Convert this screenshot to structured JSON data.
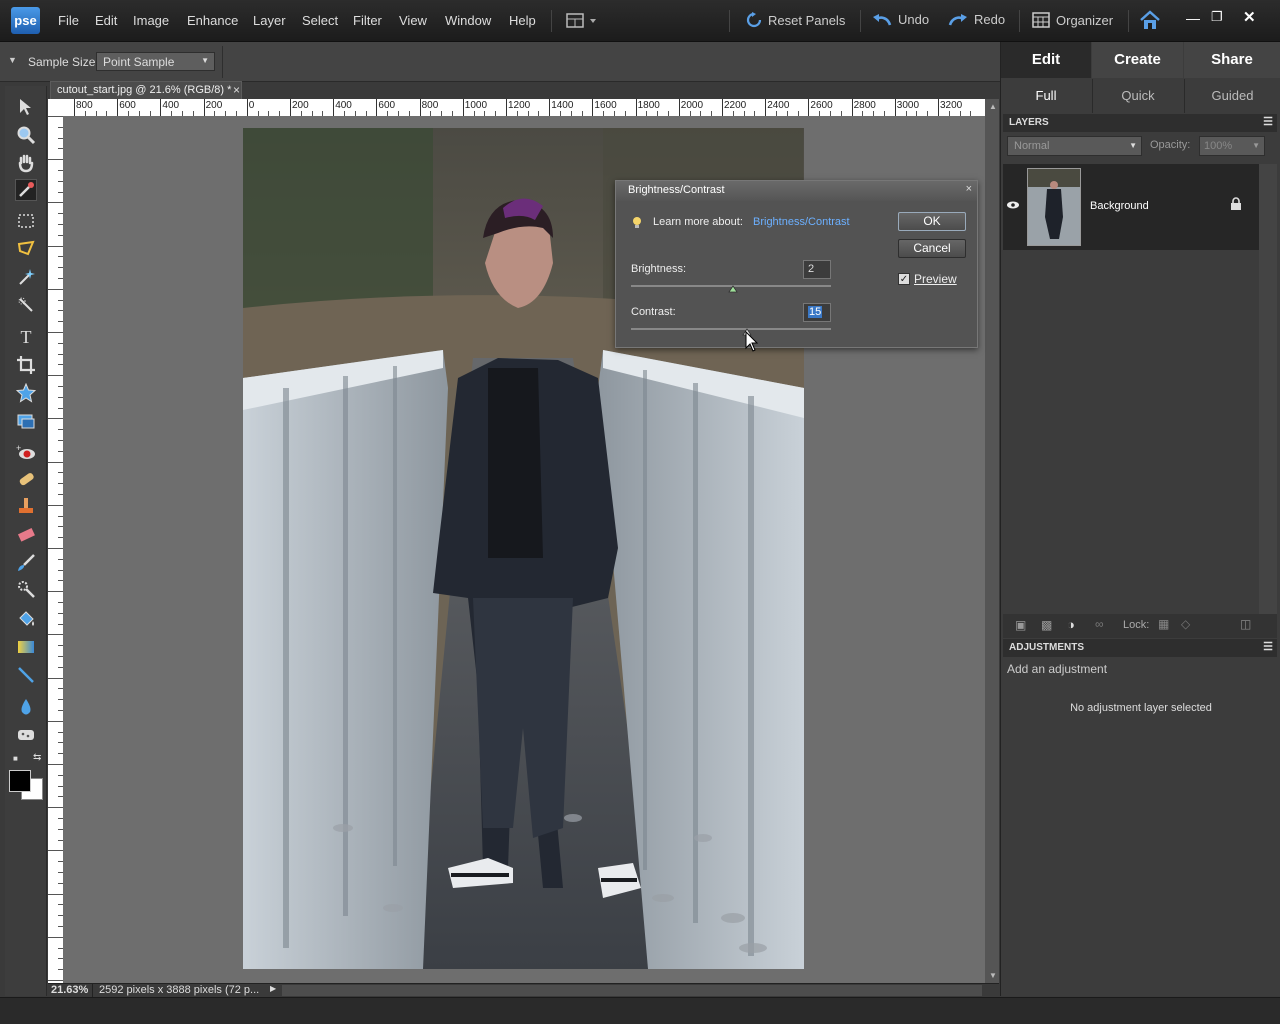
{
  "app": {
    "logo": "pse"
  },
  "menu": [
    "File",
    "Edit",
    "Image",
    "Enhance",
    "Layer",
    "Select",
    "Filter",
    "View",
    "Window",
    "Help"
  ],
  "topbar": {
    "reset_panels": "Reset Panels",
    "undo": "Undo",
    "redo": "Redo",
    "organizer": "Organizer"
  },
  "options": {
    "sample_size_label": "Sample Size:",
    "sample_size_value": "Point Sample"
  },
  "document": {
    "tab_title": "cutout_start.jpg @ 21.6% (RGB/8) *"
  },
  "ruler": {
    "h_ticks": [
      "800",
      "600",
      "400",
      "200",
      "0",
      "200",
      "400",
      "600",
      "800",
      "1000",
      "1200",
      "1400",
      "1600",
      "1800",
      "2000",
      "2200",
      "2400",
      "2600",
      "2800",
      "3000",
      "3200"
    ]
  },
  "status": {
    "zoom": "21.63%",
    "info": "2592 pixels x 3888 pixels (72 p..."
  },
  "dialog": {
    "title": "Brightness/Contrast",
    "learn_prefix": "Learn more about:",
    "learn_link": "Brightness/Contrast",
    "ok": "OK",
    "cancel": "Cancel",
    "preview": "Preview",
    "preview_checked": true,
    "brightness_label": "Brightness:",
    "brightness_value": "2",
    "contrast_label": "Contrast:",
    "contrast_value": "15"
  },
  "right_panel": {
    "tabs": [
      "Edit",
      "Create",
      "Share"
    ],
    "subtabs": [
      "Full",
      "Quick",
      "Guided"
    ],
    "layers_header": "LAYERS",
    "blend_mode": "Normal",
    "opacity_label": "Opacity:",
    "opacity_value": "100%",
    "layer_name": "Background",
    "lock_label": "Lock:",
    "adjustments_header": "ADJUSTMENTS",
    "add_adjustment": "Add an adjustment",
    "no_adjustment": "No adjustment layer selected"
  },
  "colors": {
    "accent": "#5a9fe6",
    "link": "#6cb0ff"
  }
}
